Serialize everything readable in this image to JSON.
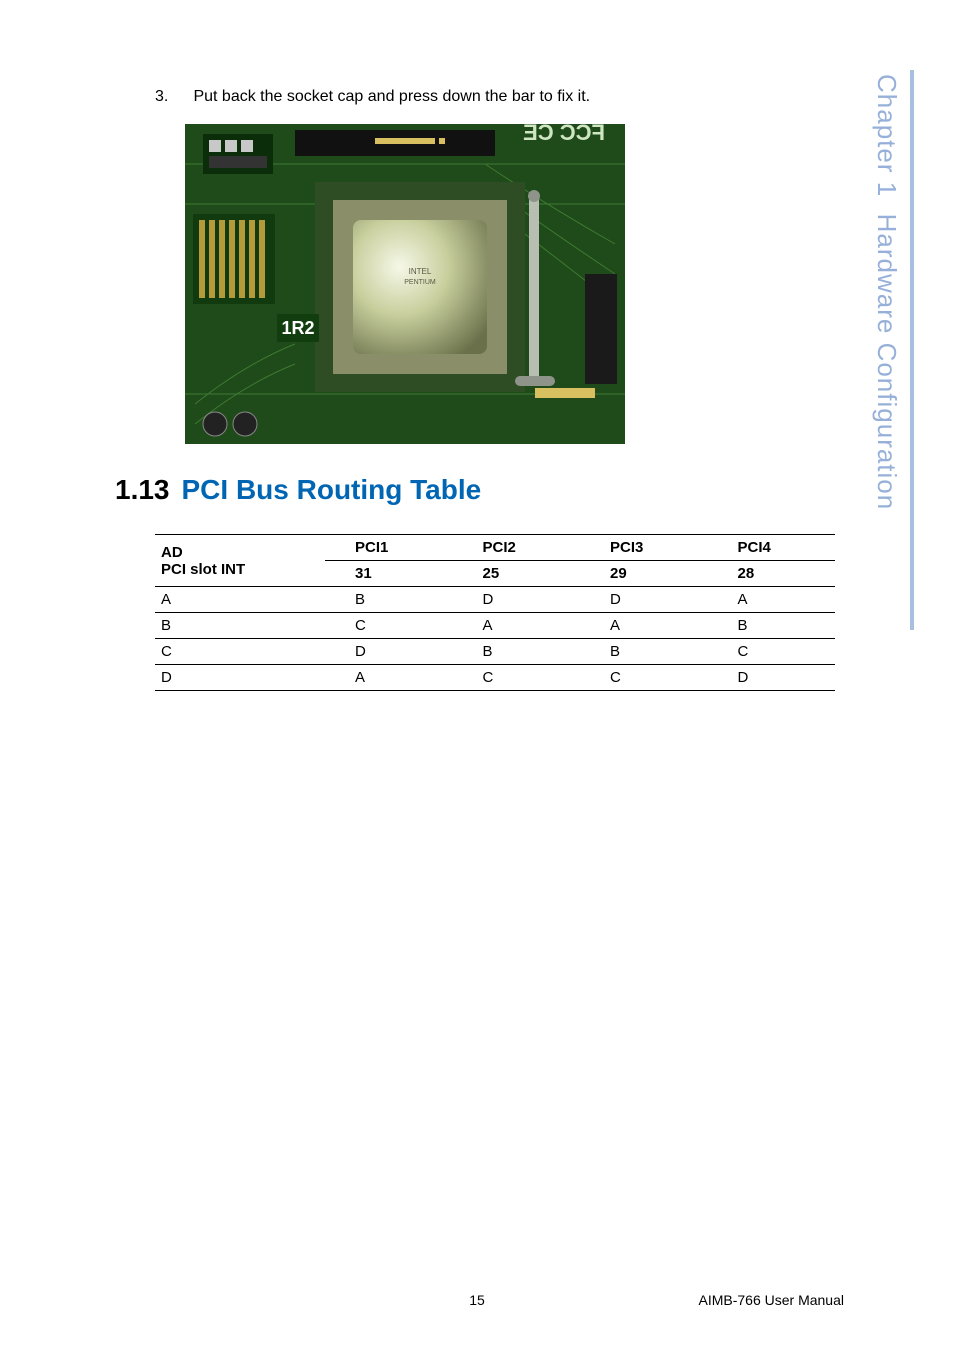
{
  "step": {
    "number": "3.",
    "text": "Put back the socket cap and press down the bar to fix it."
  },
  "heading": {
    "number": "1.13",
    "title": "PCI Bus Routing Table"
  },
  "side": {
    "chapter_label": "Chapter 1",
    "section_label": "Hardware Configuration"
  },
  "table": {
    "head_row1_label": "AD",
    "head_row2_label": "PCI slot INT",
    "columns": [
      "PCI1",
      "PCI2",
      "PCI3",
      "PCI4"
    ],
    "ad_values": [
      "31",
      "25",
      "29",
      "28"
    ],
    "rows": [
      {
        "label": "A",
        "cells": [
          "B",
          "D",
          "D",
          "A"
        ]
      },
      {
        "label": "B",
        "cells": [
          "C",
          "A",
          "A",
          "B"
        ]
      },
      {
        "label": "C",
        "cells": [
          "D",
          "B",
          "B",
          "C"
        ]
      },
      {
        "label": "D",
        "cells": [
          "A",
          "C",
          "C",
          "D"
        ]
      }
    ]
  },
  "footer": {
    "page": "15",
    "manual": "AIMB-766 User Manual"
  },
  "photo": {
    "label": "1R2"
  }
}
